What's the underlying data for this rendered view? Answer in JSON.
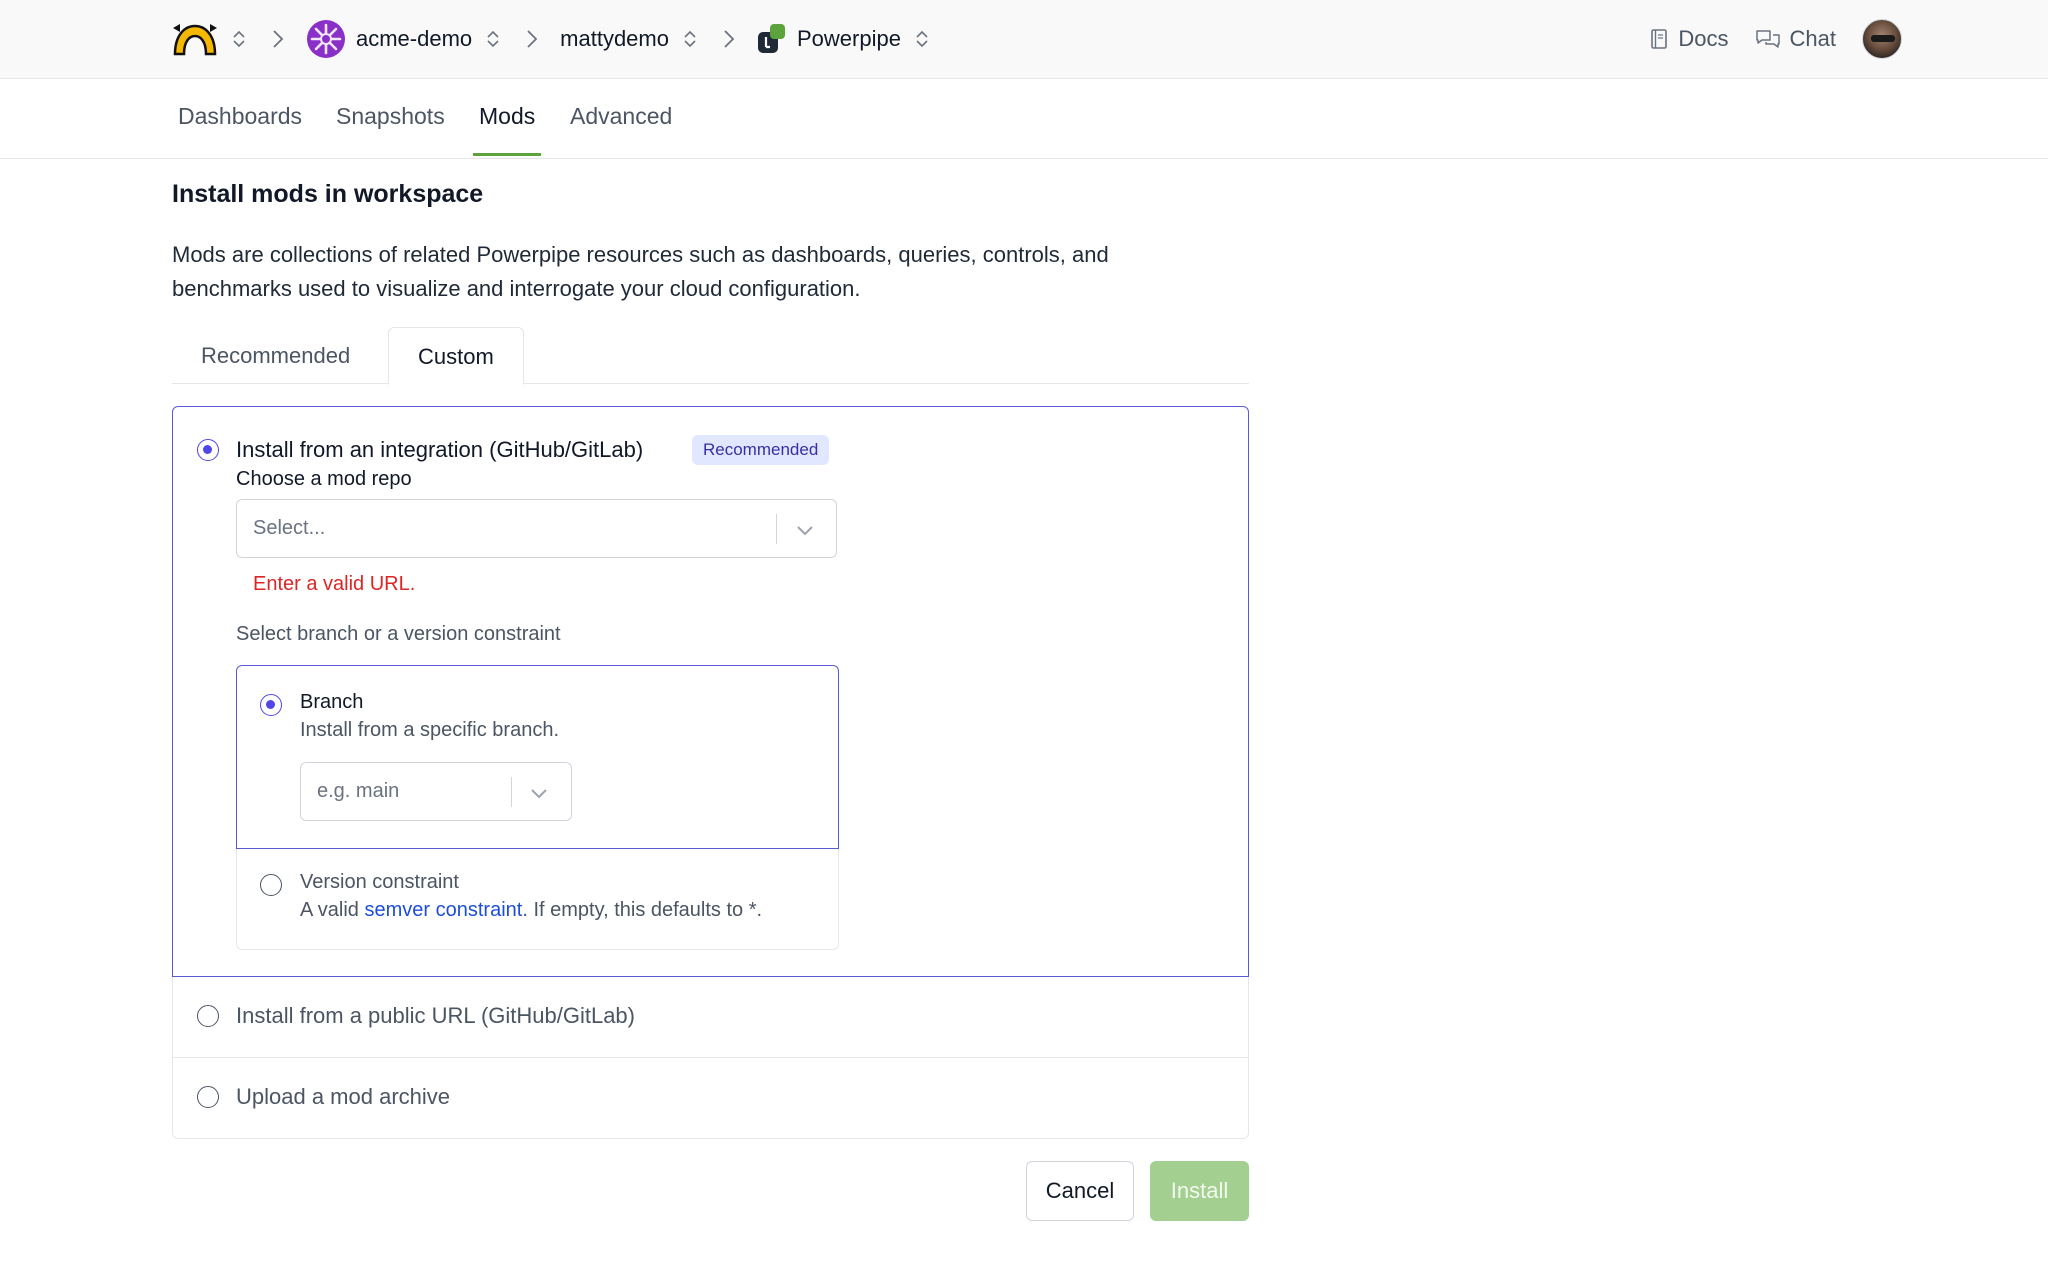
{
  "breadcrumbs": {
    "org": "acme-demo",
    "workspace": "mattydemo",
    "product": "Powerpipe"
  },
  "header": {
    "docs_label": "Docs",
    "chat_label": "Chat"
  },
  "nav_tabs": [
    {
      "label": "Dashboards",
      "active": false
    },
    {
      "label": "Snapshots",
      "active": false
    },
    {
      "label": "Mods",
      "active": true
    },
    {
      "label": "Advanced",
      "active": false
    }
  ],
  "page": {
    "title": "Install mods in workspace",
    "description": "Mods are collections of related Powerpipe resources such as dashboards, queries, controls, and benchmarks used to visualize and interrogate your cloud configuration."
  },
  "sub_tabs": [
    {
      "label": "Recommended",
      "active": false
    },
    {
      "label": "Custom",
      "active": true
    }
  ],
  "install_options": {
    "integration": {
      "label": "Install from an integration (GitHub/GitLab)",
      "badge": "Recommended",
      "selected": true,
      "repo_label": "Choose a mod repo",
      "repo_placeholder": "Select...",
      "error": "Enter a valid URL.",
      "constraint_label": "Select branch or a version constraint",
      "branch": {
        "title": "Branch",
        "description": "Install from a specific branch.",
        "placeholder": "e.g. main",
        "selected": true
      },
      "version": {
        "title": "Version constraint",
        "desc_prefix": "A valid ",
        "desc_link": "semver constraint",
        "desc_suffix": ". If empty, this defaults to *.",
        "selected": false
      }
    },
    "public_url": {
      "label": "Install from a public URL (GitHub/GitLab)",
      "selected": false
    },
    "archive": {
      "label": "Upload a mod archive",
      "selected": false
    }
  },
  "actions": {
    "cancel": "Cancel",
    "install": "Install"
  },
  "colors": {
    "accent_green": "#5da33b",
    "radio_selected": "#4f46e5",
    "error": "#dc2626",
    "install_disabled": "#a3cf90"
  }
}
